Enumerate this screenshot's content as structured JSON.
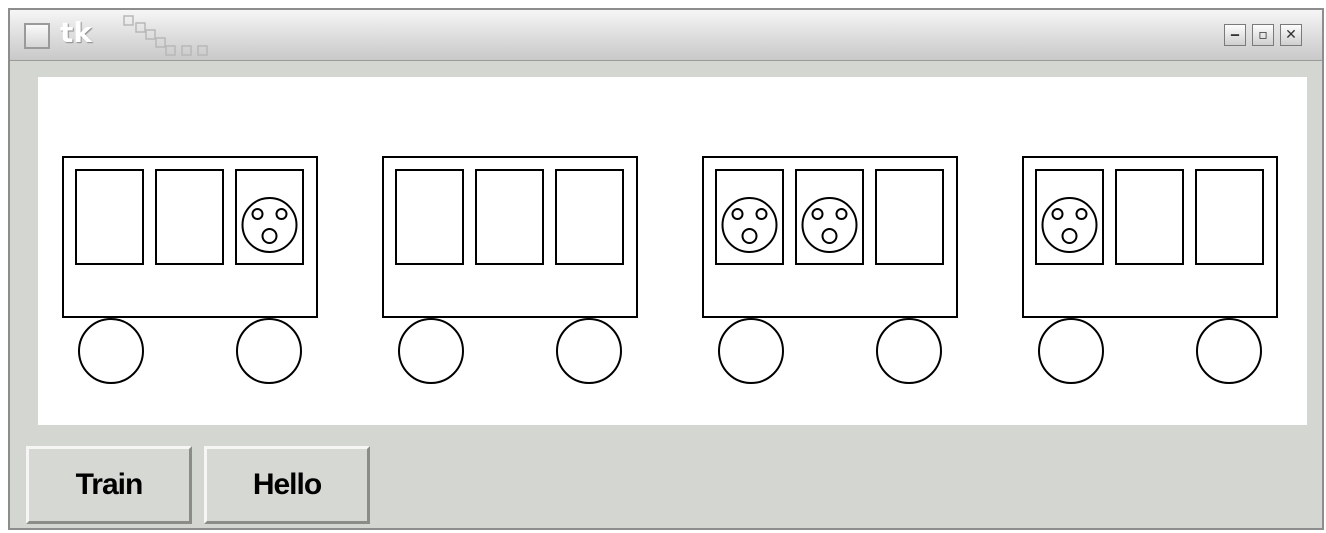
{
  "window": {
    "title": "tk",
    "controls": {
      "minimize": "‒",
      "maximize": "▫",
      "close": "✕"
    }
  },
  "canvas": {
    "cars": [
      {
        "passengers": [
          false,
          false,
          true
        ]
      },
      {
        "passengers": [
          false,
          false,
          false
        ]
      },
      {
        "passengers": [
          true,
          true,
          false
        ]
      },
      {
        "passengers": [
          true,
          false,
          false
        ]
      }
    ]
  },
  "buttons": {
    "train": "Train",
    "hello": "Hello"
  }
}
